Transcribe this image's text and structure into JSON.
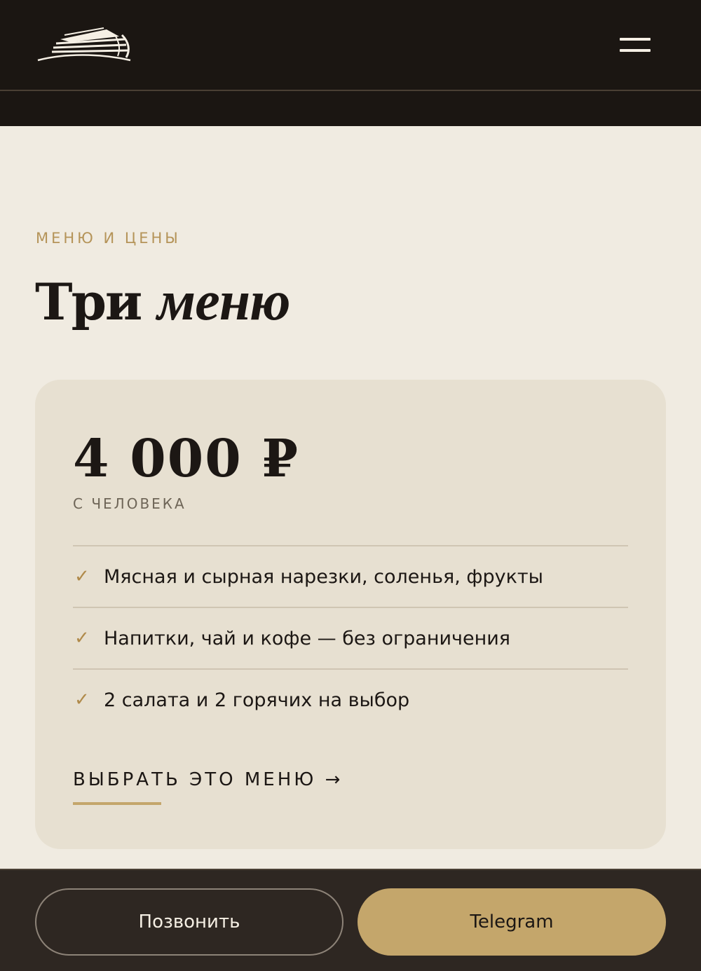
{
  "header": {
    "logo_icon": "ark-boat-logo-icon",
    "menu_icon": "hamburger-menu-icon"
  },
  "section": {
    "eyebrow": "МЕНЮ И ЦЕНЫ",
    "title_regular": "Три",
    "title_italic": "меню"
  },
  "card": {
    "price": "4 000 ₽",
    "per_person": "С ЧЕЛОВЕКА",
    "features": [
      {
        "icon": "check-icon",
        "check": "✓",
        "text": "Мясная и сырная нарезки, соленья, фрукты"
      },
      {
        "icon": "check-icon",
        "check": "✓",
        "text": "Напитки, чай и кофе — без ограничения"
      },
      {
        "icon": "check-icon",
        "check": "✓",
        "text": "2 салата и 2 горячих на выбор"
      }
    ],
    "cta_label": "ВЫБРАТЬ ЭТО МЕНЮ →"
  },
  "bottom_bar": {
    "call_label": "Позвонить",
    "telegram_label": "Telegram"
  },
  "colors": {
    "header_bg": "#1b1612",
    "page_bg": "#f0ebe1",
    "card_bg": "#e7e0d1",
    "accent_gold": "#c4a66b",
    "bottom_bar_bg": "#2e2722"
  }
}
